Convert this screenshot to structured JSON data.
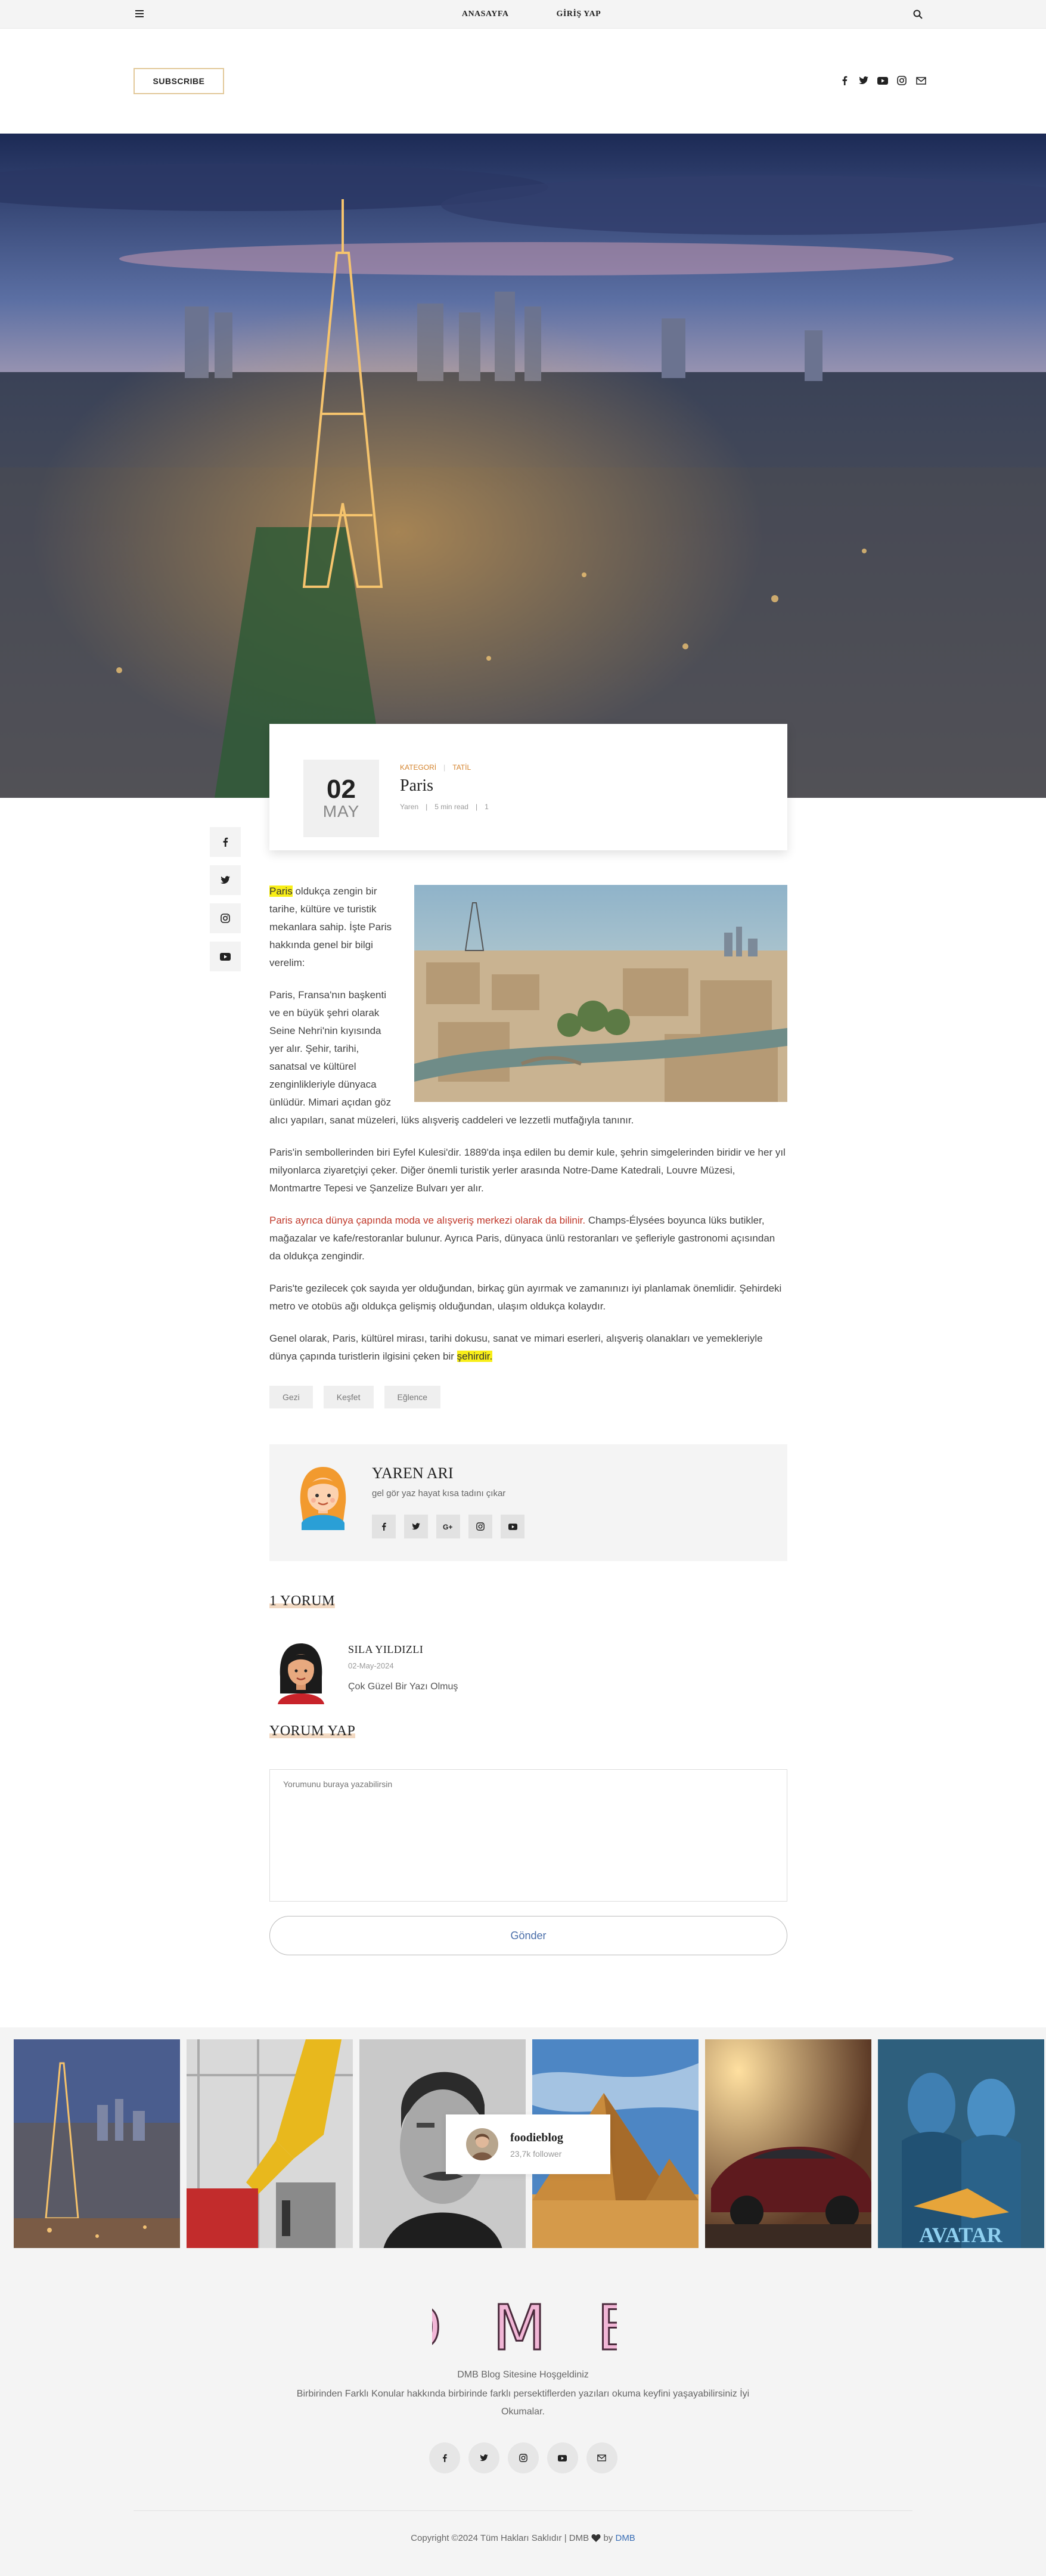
{
  "nav": {
    "links": [
      "ANASAYFA",
      "GİRİŞ YAP"
    ]
  },
  "header": {
    "subscribe_label": "SUBSCRIBE",
    "social_icons": [
      "facebook-icon",
      "twitter-icon",
      "youtube-icon",
      "instagram-icon",
      "mail-icon"
    ]
  },
  "post": {
    "day": "02",
    "month": "MAY",
    "category_label": "KATEGORİ",
    "category": "TATİL",
    "title": "Paris",
    "author": "Yaren",
    "read_time": "5 min read",
    "comment_count": "1"
  },
  "article": {
    "p1_highlight": "Paris",
    "p1": " oldukça zengin bir tarihe, kültüre ve turistik mekanlara sahip. İşte Paris hakkında genel bir bilgi verelim:",
    "p2": "Paris, Fransa'nın başkenti ve en büyük şehri olarak Seine Nehri'nin kıyısında yer alır. Şehir, tarihi, sanatsal ve kültürel zenginlikleriyle dünyaca ünlüdür. Mimari açıdan göz alıcı yapıları, sanat müzeleri, lüks alışveriş caddeleri ve lezzetli mutfağıyla tanınır.",
    "p3": "Paris'in sembollerinden biri Eyfel Kulesi'dir. 1889'da inşa edilen bu demir kule, şehrin simgelerinden biridir ve her yıl milyonlarca ziyaretçiyi çeker. Diğer önemli turistik yerler arasında Notre-Dame Katedrali, Louvre Müzesi, Montmartre Tepesi ve Şanzelize Bulvarı yer alır.",
    "p4_red": "Paris ayrıca dünya çapında moda ve alışveriş merkezi olarak da bilinir.",
    "p4": " Champs-Élysées boyunca lüks butikler, mağazalar ve kafe/restoranlar bulunur. Ayrıca Paris, dünyaca ünlü restoranları ve şefleriyle gastronomi açısından da oldukça zengindir.",
    "p5": "Paris'te gezilecek çok sayıda yer olduğundan, birkaç gün ayırmak ve zamanınızı iyi planlamak önemlidir. Şehirdeki metro ve otobüs ağı oldukça gelişmiş olduğundan, ulaşım oldukça kolaydır.",
    "p6": "Genel olarak, Paris, kültürel mirası, tarihi dokusu, sanat ve mimari eserleri, alışveriş olanakları ve yemekleriyle dünya çapında turistlerin ilgisini çeken bir ",
    "p6_highlight": "şehirdir."
  },
  "tags": [
    "Gezi",
    "Keşfet",
    "Eğlence"
  ],
  "author_box": {
    "name": "YAREN ARI",
    "bio": "gel gör yaz hayat kısa tadını çıkar",
    "social_icons": [
      "facebook-icon",
      "twitter-icon",
      "google-plus-icon",
      "instagram-icon",
      "youtube-icon"
    ]
  },
  "comments": {
    "heading": "1 YORUM",
    "items": [
      {
        "author": "SILA YILDIZLI",
        "date": "02-May-2024",
        "text": "Çok Güzel Bir Yazı Olmuş"
      }
    ]
  },
  "reply": {
    "heading": "YORUM YAP",
    "placeholder": "Yorumunu buraya yazabilirsin",
    "submit_label": "Gönder"
  },
  "instagram": {
    "name": "foodieblog",
    "followers": "23,7k follower",
    "images": [
      "paris",
      "robot-arm",
      "portrait",
      "pyramids",
      "car",
      "avatar-poster"
    ],
    "avatar_poster_text": "AVATAR"
  },
  "footer": {
    "logo": "D M B",
    "welcome": "DMB Blog Sitesine Hoşgeldiniz",
    "description": "Birbirinden Farklı Konular hakkında birbirinde farklı persektiflerden yazıları okuma keyfini yaşayabilirsiniz İyi Okumalar.",
    "social_icons": [
      "facebook-icon",
      "twitter-icon",
      "instagram-icon",
      "youtube-icon",
      "mail-icon"
    ],
    "copyright_prefix": "Copyright ©2024 Tüm Hakları Saklıdır | DMB",
    "copyright_by": "by",
    "copyright_link": "DMB"
  }
}
